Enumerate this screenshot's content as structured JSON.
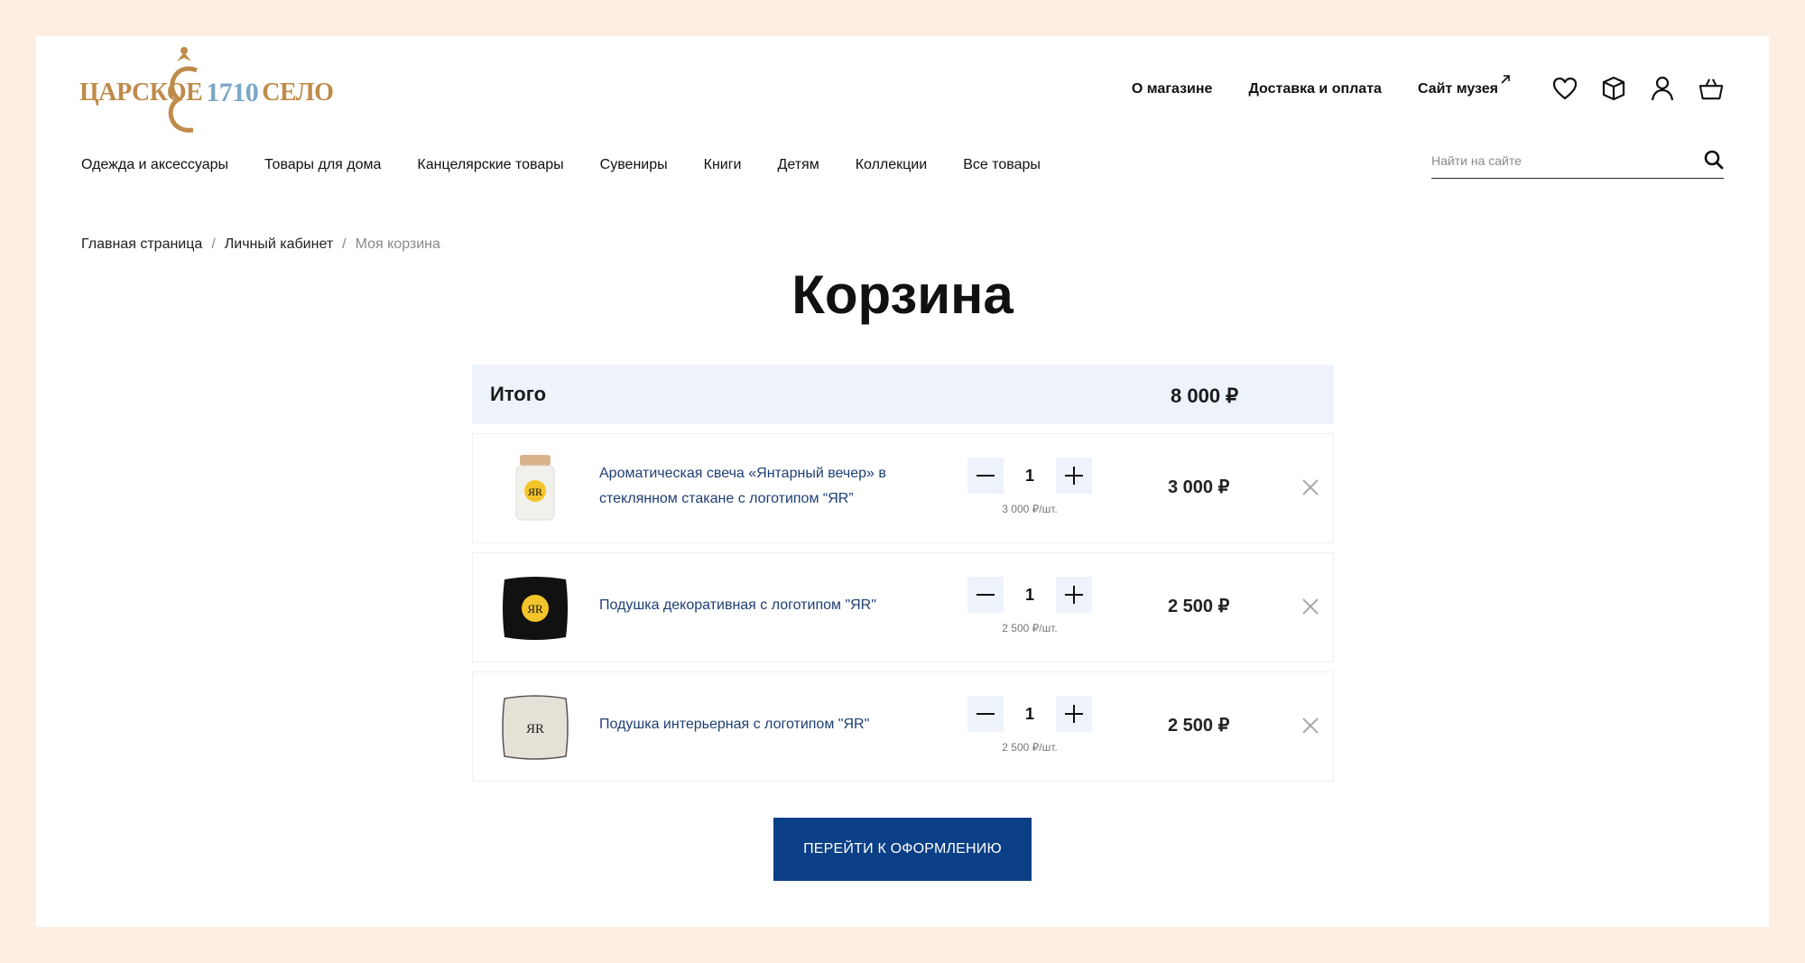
{
  "brand": {
    "name_left": "ЦАРСКОЕ",
    "year": "1710",
    "name_right": "СЕЛО"
  },
  "topnav": [
    {
      "label": "О магазине"
    },
    {
      "label": "Доставка и оплата"
    },
    {
      "label": "Сайт музея"
    }
  ],
  "header_icons": [
    "heart-icon",
    "box-icon",
    "user-icon",
    "basket-icon"
  ],
  "categories": [
    "Одежда и аксессуары",
    "Товары для дома",
    "Канцелярские товары",
    "Сувениры",
    "Книги",
    "Детям",
    "Коллекции",
    "Все товары"
  ],
  "search": {
    "placeholder": "Найти на сайте"
  },
  "breadcrumb": {
    "home": "Главная страница",
    "account": "Личный кабинет",
    "current": "Моя корзина",
    "separator": "/"
  },
  "page_title": "Корзина",
  "summary": {
    "label": "Итого",
    "total": "8 000 ₽"
  },
  "items": [
    {
      "name": "Ароматическая свеча «Янтарный вечер» в стеклянном стакане с логотипом “ЯR”",
      "qty": "1",
      "unit_price": "3 000 ₽/шт.",
      "price": "3 000 ₽",
      "image": "candle"
    },
    {
      "name": "Подушка декоративная с логотипом \"ЯR\"",
      "qty": "1",
      "unit_price": "2 500 ₽/шт.",
      "price": "2 500 ₽",
      "image": "black-pillow"
    },
    {
      "name": "Подушка интерьерная с логотипом \"ЯR\"",
      "qty": "1",
      "unit_price": "2 500 ₽/шт.",
      "price": "2 500 ₽",
      "image": "beige-pillow"
    }
  ],
  "checkout_label": "ПЕРЕЙТИ К ОФОРМЛЕНИЮ",
  "colors": {
    "frame_bg": "#fceee3",
    "accent_blue": "#0b3f86",
    "summary_bg": "#eef3fb",
    "link_blue": "#1d3f73",
    "logo_gold": "#c08a4a"
  }
}
